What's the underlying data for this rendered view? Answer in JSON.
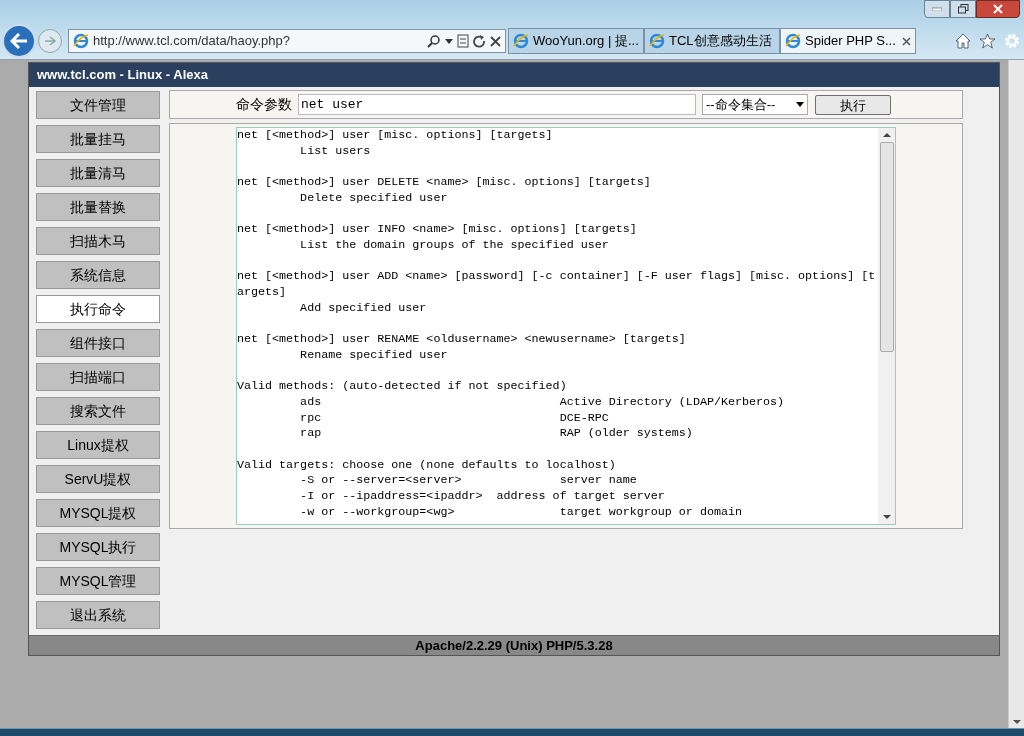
{
  "browser": {
    "address": "http://www.tcl.com/data/haoy.php?",
    "tabs": [
      {
        "label": "WooYun.org | 提...",
        "selected": false
      },
      {
        "label": "TCL创意感动生活",
        "selected": false
      },
      {
        "label": "Spider PHP S...",
        "selected": true
      }
    ]
  },
  "page": {
    "header": "www.tcl.com - Linux - Alexa",
    "menu": [
      {
        "label": "文件管理",
        "selected": false
      },
      {
        "label": "批量挂马",
        "selected": false
      },
      {
        "label": "批量清马",
        "selected": false
      },
      {
        "label": "批量替换",
        "selected": false
      },
      {
        "label": "扫描木马",
        "selected": false
      },
      {
        "label": "系统信息",
        "selected": false
      },
      {
        "label": "执行命令",
        "selected": true
      },
      {
        "label": "组件接口",
        "selected": false
      },
      {
        "label": "扫描端口",
        "selected": false
      },
      {
        "label": "搜索文件",
        "selected": false
      },
      {
        "label": "Linux提权",
        "selected": false
      },
      {
        "label": "ServU提权",
        "selected": false
      },
      {
        "label": "MYSQL提权",
        "selected": false
      },
      {
        "label": "MYSQL执行",
        "selected": false
      },
      {
        "label": "MYSQL管理",
        "selected": false
      },
      {
        "label": "退出系统",
        "selected": false
      }
    ],
    "command_label": "命令参数",
    "command_value": "net user",
    "command_set": "--命令集合--",
    "run_button": "执行",
    "output": "net [<method>] user [misc. options] [targets]\n         List users\n\nnet [<method>] user DELETE <name> [misc. options] [targets]\n         Delete specified user\n\nnet [<method>] user INFO <name> [misc. options] [targets]\n         List the domain groups of the specified user\n\nnet [<method>] user ADD <name> [password] [-c container] [-F user flags] [misc. options] [t\nargets]\n         Add specified user\n\nnet [<method>] user RENAME <oldusername> <newusername> [targets]\n         Rename specified user\n\nValid methods: (auto-detected if not specified)\n         ads                                  Active Directory (LDAP/Kerberos)\n         rpc                                  DCE-RPC\n         rap                                  RAP (older systems)\n\nValid targets: choose one (none defaults to localhost)\n         -S or --server=<server>              server name\n         -I or --ipaddress=<ipaddr>  address of target server\n         -w or --workgroup=<wg>               target workgroup or domain",
    "footer": "Apache/2.2.29 (Unix) PHP/5.3.28"
  }
}
